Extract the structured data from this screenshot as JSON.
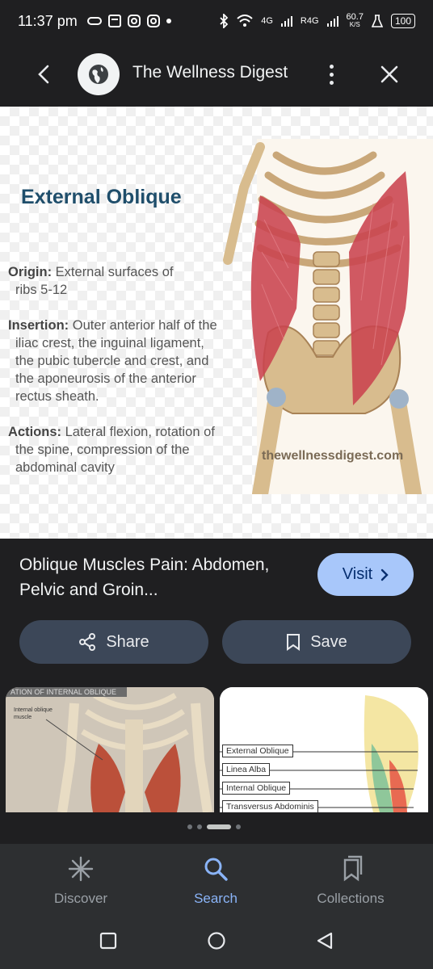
{
  "status_bar": {
    "time": "11:37 pm",
    "net_4g": "4G",
    "net_r4g": "R4G",
    "speed": "60.7",
    "speed_unit": "K/S",
    "battery": "100"
  },
  "header": {
    "site_name": "The Wellness Digest",
    "back_icon": "chevron-left-icon",
    "globe_icon": "globe-icon",
    "more_icon": "more-vert-icon",
    "close_icon": "close-icon"
  },
  "hero": {
    "title": "External Oblique",
    "origin_label": "Origin:",
    "origin_text_1": "External surfaces of",
    "origin_text_2": "ribs 5-12",
    "insertion_label": "Insertion:",
    "insertion_text_1": "Outer anterior half of the",
    "insertion_text_2": "iliac crest, the inguinal ligament,",
    "insertion_text_3": "the pubic tubercle and crest, and",
    "insertion_text_4": "the aponeurosis of the anterior",
    "insertion_text_5": "rectus sheath.",
    "actions_label": "Actions:",
    "actions_text_1": "Lateral flexion, rotation of",
    "actions_text_2": "the spine, compression of the",
    "actions_text_3": "abdominal cavity",
    "watermark": "thewellnessdigest.com"
  },
  "result": {
    "title": "Oblique Muscles Pain: Abdomen, Pelvic and Groin...",
    "visit_label": "Visit",
    "share_label": "Share",
    "save_label": "Save"
  },
  "related": {
    "thumb1_banner": "ATION OF INTERNAL OBLIQUE",
    "thumb1_label": "Internal oblique muscle",
    "thumb2_labels": [
      "External Oblique",
      "Linea Alba",
      "Internal Oblique",
      "Transversus Abdominis"
    ]
  },
  "bottom_nav": {
    "items": [
      {
        "label": "Discover",
        "icon": "asterisk-icon",
        "active": false
      },
      {
        "label": "Search",
        "icon": "search-icon",
        "active": true
      },
      {
        "label": "Collections",
        "icon": "collections-icon",
        "active": false
      }
    ]
  },
  "colors": {
    "background": "#1f1f21",
    "visit_button": "#a8c7fa",
    "pill_button": "#3c4758",
    "active_nav": "#8ab4f8",
    "hero_title": "#1f4e6b"
  }
}
